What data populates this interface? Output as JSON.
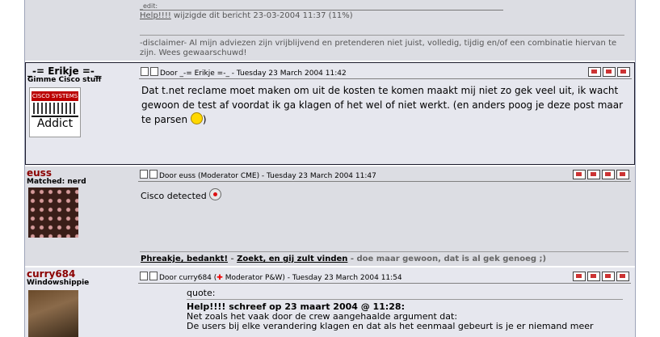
{
  "post1": {
    "edit_label": "_edit:",
    "edit_user": "Help!!!!",
    "edit_text": "wijzigde dit bericht 23-03-2004 11:37 (11%)",
    "disclaimer": "-disclaimer- Al mijn adviezen zijn vrijblijvend en pretenderen niet juist, volledig, tijdig en/of een combinatie hiervan te zijn. Wees gewaarschuwd!"
  },
  "post2": {
    "username": "_-= Erikje =-_",
    "usertitle": "Gimme Cisco stuff",
    "avatar_top": "CISCO SYSTEMS",
    "avatar_bottom": "Addict",
    "header": "Door _-= Erikje =-_ - Tuesday 23 March 2004 11:42",
    "body": "Dat t.net reclame moet maken om uit de kosten te komen maakt mij niet zo gek veel uit, ik wacht gewoon de test af voordat ik ga klagen of het wel of niet werkt. (en anders poog je deze post maar te parsen"
  },
  "post3": {
    "username": "euss",
    "usertitle": "Matched: nerd",
    "header": "Door euss (Moderator CME) - Tuesday 23 March 2004 11:47",
    "body": "Cisco detected",
    "sig_link1": "Phreakje, bedankt!",
    "sig_sep1": " - ",
    "sig_link2": "Zoekt, en gij zult vinden",
    "sig_tail": " - doe maar gewoon, dat is al gek genoeg ;)"
  },
  "post4": {
    "username": "curry684",
    "usertitle": "Windowshippie",
    "header_pre": "Door curry684 (",
    "header_post": " Moderator P&W) - Tuesday 23 March 2004 11:54",
    "quote_label": "quote:",
    "quote_title": "Help!!!! schreef op 23 maart 2004 @ 11:28:",
    "quote_line1": "Net zoals het vaak door de crew aangehaalde argument dat:",
    "quote_line2": "De users bij elke verandering klagen en dat als het eenmaal gebeurt is je er niemand meer"
  },
  "colors": {
    "username_red": "#8b0000",
    "post_grey": "#dcdde3"
  }
}
